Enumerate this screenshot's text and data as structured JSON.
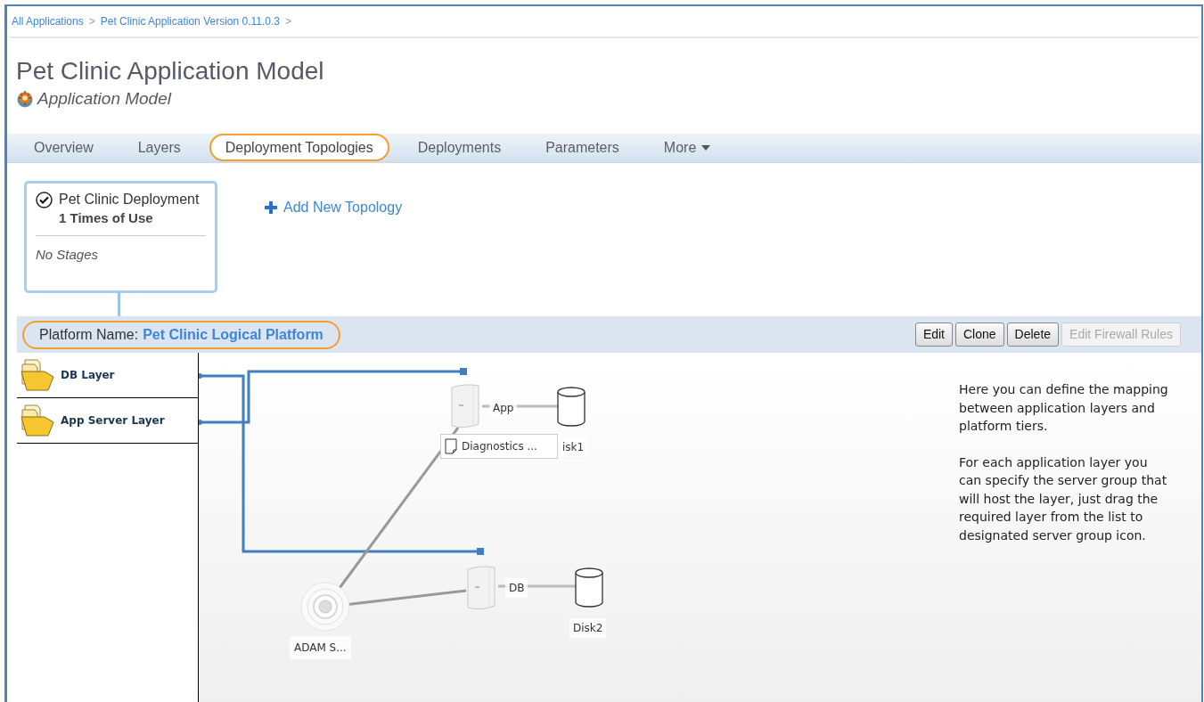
{
  "breadcrumb": [
    {
      "label": "All Applications",
      "separator": ">"
    },
    {
      "label": "Pet Clinic Application Version 0.11.0.3",
      "separator": ">"
    }
  ],
  "title": "Pet Clinic Application Model",
  "subtitle": "Application Model",
  "tabs": [
    {
      "label": "Overview",
      "selected": false,
      "has_menu": false
    },
    {
      "label": "Layers",
      "selected": false,
      "has_menu": false
    },
    {
      "label": "Deployment Topologies",
      "selected": true,
      "has_menu": false
    },
    {
      "label": "Deployments",
      "selected": false,
      "has_menu": false
    },
    {
      "label": "Parameters",
      "selected": false,
      "has_menu": false
    },
    {
      "label": "More",
      "selected": false,
      "has_menu": true
    }
  ],
  "topologies": [
    {
      "name": "Pet Clinic Deployment",
      "uses": "1 Times of Use",
      "stages": "No Stages",
      "selected": true
    }
  ],
  "add_topology": "Add New Topology",
  "platform": {
    "label": "Platform Name:",
    "name": "Pet Clinic Logical Platform"
  },
  "actions": [
    {
      "label": "Edit",
      "disabled": false
    },
    {
      "label": "Clone",
      "disabled": false
    },
    {
      "label": "Delete",
      "disabled": false
    },
    {
      "label": "Edit Firewall Rules",
      "disabled": true
    }
  ],
  "layers": [
    {
      "name": "DB Layer"
    },
    {
      "name": "App Server Layer"
    }
  ],
  "diagram": {
    "servers": [
      {
        "label": "App"
      },
      {
        "label": "DB"
      }
    ],
    "disks": [
      {
        "label": "isk1"
      },
      {
        "label": "Disk2"
      }
    ],
    "hub": {
      "label": "ADAM S..."
    },
    "attachment": {
      "label": "Diagnostics ..."
    }
  },
  "help": [
    "Here you can define the mapping between application layers and platform tiers.",
    "For each application layer you can specify the server group that will host the layer, just drag the required layer from the list to designated server group icon."
  ]
}
